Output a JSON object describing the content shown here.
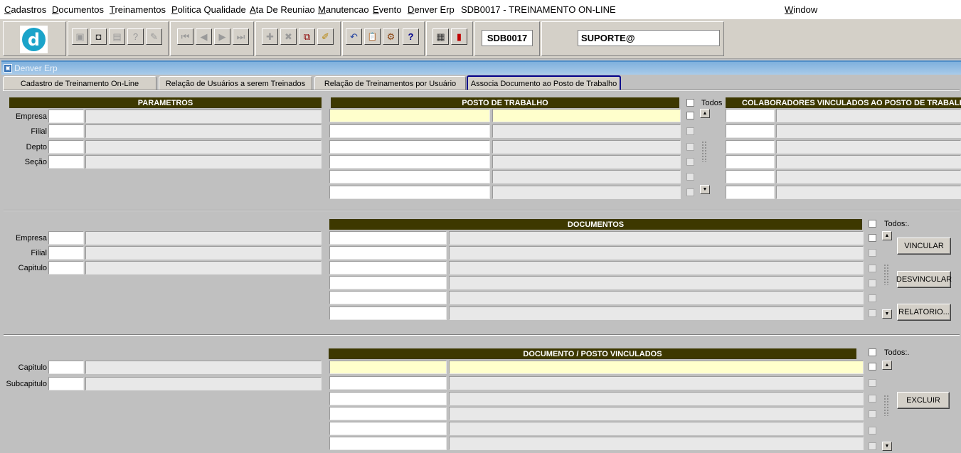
{
  "menu": {
    "items": [
      {
        "u": "C",
        "rest": "adastros"
      },
      {
        "u": "D",
        "rest": "ocumentos"
      },
      {
        "u": "T",
        "rest": "reinamentos"
      },
      {
        "u": "P",
        "rest": "olitica Qualidade"
      },
      {
        "u": "A",
        "rest": "ta De Reuniao"
      },
      {
        "u": "M",
        "rest": "anutencao"
      },
      {
        "u": "E",
        "rest": "vento"
      },
      {
        "u": "D",
        "rest": "enver Erp"
      },
      {
        "u": "",
        "rest": "SDB0017 - TREINAMENTO ON-LINE"
      },
      {
        "u": "W",
        "rest": "indow"
      }
    ]
  },
  "toolbar": {
    "form_code": "SDB0017",
    "user": "SUPORTE@",
    "icons": [
      "save-icon",
      "print-preview-icon",
      "print-icon",
      "query-icon",
      "query-execute-icon",
      "first-record-icon",
      "previous-record-icon",
      "next-record-icon",
      "last-record-icon",
      "insert-record-icon",
      "delete-record-icon",
      "edit-icon",
      "clear-icon",
      "undo-icon",
      "clipboard-icon",
      "lov-icon",
      "help-icon",
      "menu-icon",
      "exit-icon"
    ],
    "glyphs": [
      "▣",
      "◘",
      "▤",
      "?",
      "✎",
      "⏮",
      "◀",
      "▶",
      "⏭",
      "✚",
      "✖",
      "⧉",
      "✐",
      "↶",
      "📋",
      "⚙",
      "?",
      "▦",
      "▮"
    ]
  },
  "window": {
    "title": "Denver Erp"
  },
  "tabs": [
    "Cadastro de Treinamento On-Line",
    "Relação de Usuários a serem Treinados",
    "Relação de Treinamentos por Usuário",
    "Associa Documento ao Posto de Trabalho"
  ],
  "section1": {
    "params_header": "PARAMETROS",
    "posto_header": "POSTO DE TRABALHO",
    "todos_label": "Todos",
    "colab_header": "COLABORADORES VINCULADOS AO POSTO DE TRABALHO",
    "labels": [
      "Empresa",
      "Filial",
      "Depto",
      "Seção"
    ]
  },
  "section2": {
    "doc_header": "DOCUMENTOS",
    "todos_label": "Todos:.",
    "labels": [
      "Empresa",
      "Filial",
      "Capitulo"
    ],
    "buttons": {
      "vincular": "VINCULAR",
      "desvincular": "DESVINCULAR",
      "relatorio": "RELATORIO..."
    }
  },
  "section3": {
    "header": "DOCUMENTO / POSTO VINCULADOS",
    "todos_label": "Todos:.",
    "labels": [
      "Capitulo",
      "Subcapitulo"
    ],
    "buttons": {
      "excluir": "EXCLUIR"
    }
  },
  "colors": {
    "header_bg": "#3d3800",
    "current_row": "#ffffcc",
    "tab_active_border": "#00008b",
    "title_bar": "#7fb0dd"
  }
}
